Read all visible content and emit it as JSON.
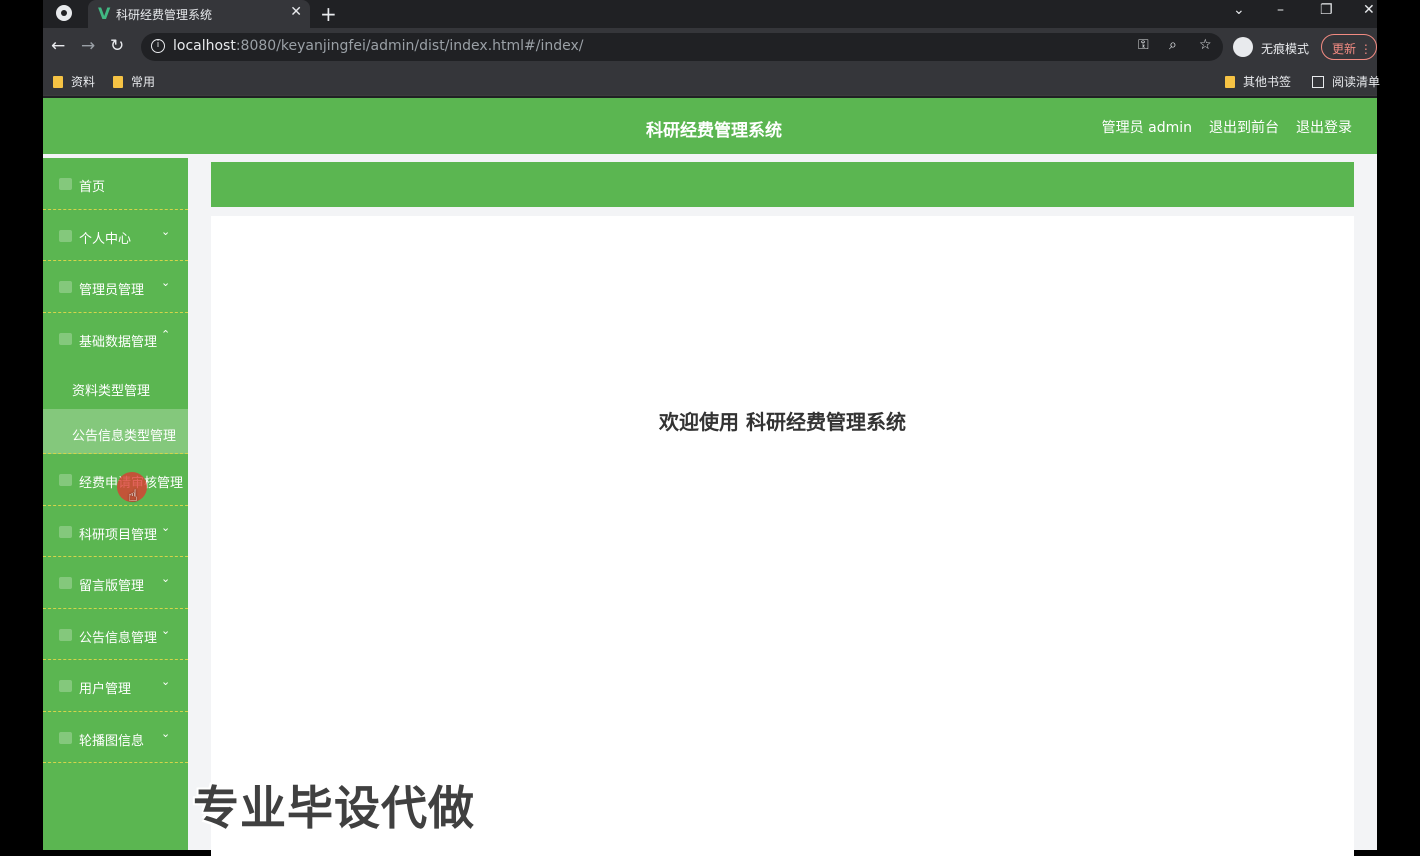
{
  "browser": {
    "tab_title": "科研经费管理系统",
    "tab_favicon": "vue-icon",
    "url_host": "localhost",
    "url_rest": ":8080/keyanjingfei/admin/dist/index.html#/index/",
    "incognito_label": "无痕模式",
    "update_label": "更新",
    "bookmarks": [
      "资料",
      "常用"
    ],
    "bookmarks_right": [
      "其他书签",
      "阅读清单"
    ]
  },
  "header": {
    "title": "科研经费管理系统",
    "user_label": "管理员 admin",
    "front_link": "退出到前台",
    "logout_link": "退出登录"
  },
  "sidebar": {
    "items": [
      {
        "label": "首页",
        "arrow": ""
      },
      {
        "label": "个人中心",
        "arrow": "⌄"
      },
      {
        "label": "管理员管理",
        "arrow": "⌄"
      },
      {
        "label": "基础数据管理",
        "arrow": "⌃"
      }
    ],
    "sub_items": [
      {
        "label": "资料类型管理"
      },
      {
        "label": "公告信息类型管理"
      }
    ],
    "items_after": [
      {
        "label": "经费申请审核管理",
        "arrow": ""
      },
      {
        "label": "科研项目管理",
        "arrow": "⌄"
      },
      {
        "label": "留言版管理",
        "arrow": "⌄"
      },
      {
        "label": "公告信息管理",
        "arrow": "⌄"
      },
      {
        "label": "用户管理",
        "arrow": "⌄"
      },
      {
        "label": "轮播图信息",
        "arrow": "⌄"
      }
    ]
  },
  "main": {
    "welcome": "欢迎使用 科研经费管理系统"
  },
  "overlay": {
    "watermark": "专业毕设代做"
  },
  "colors": {
    "brand_green": "#5bb651"
  }
}
